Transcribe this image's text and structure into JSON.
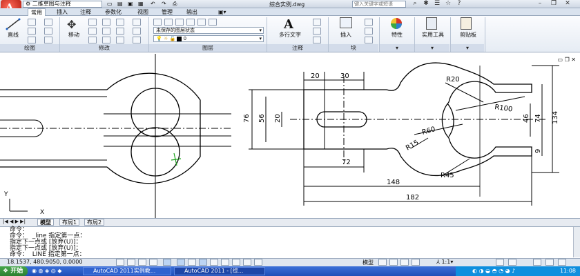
{
  "title_bar": {
    "workspace": "二维草图与注释",
    "title": "综合实例.dwg",
    "help_placeholder": "键入关键字或短语"
  },
  "tabs": [
    "常用",
    "插入",
    "注释",
    "参数化",
    "视图",
    "管理",
    "输出"
  ],
  "ribbon": {
    "draw": {
      "line_label": "直线",
      "panel_title": "绘图"
    },
    "modify": {
      "move_label": "移动",
      "panel_title": "修改"
    },
    "layers": {
      "state_value": "未保存的图层状态",
      "layer_value": "0",
      "panel_title": "图层"
    },
    "annotation": {
      "mtext_label": "多行文字",
      "panel_title": "注释"
    },
    "block": {
      "insert_label": "插入",
      "panel_title": "块"
    },
    "properties_label": "特性",
    "utilities_label": "实用工具",
    "clipboard_label": "剪贴板"
  },
  "drawing": {
    "dims": [
      "20",
      "30",
      "R20",
      "R100",
      "76",
      "56",
      "20",
      "46",
      "74",
      "134",
      "R60",
      "R15",
      "9",
      "72",
      "R45",
      "148",
      "182"
    ],
    "ucs": {
      "x": "X",
      "y": "Y"
    }
  },
  "layout_tabs": [
    "模型",
    "布局1",
    "布局2"
  ],
  "command_lines": [
    "命令：",
    "命令：  _line 指定第一点：",
    "指定下一点或 [放弃(U)]：",
    "指定下一点或 [放弃(U)]：",
    "命令：  LINE 指定第一点："
  ],
  "status": {
    "coords": "18.1537,  480.9050, 0.0000",
    "model_label": "模型",
    "scale": "1:1"
  },
  "taskbar": {
    "start": "开始",
    "tasks": [
      "AutoCAD 2011实例教...",
      "AutoCAD 2011 - [综..."
    ],
    "clock": "11:08"
  },
  "colors": {
    "accent": "#1f4fb8",
    "app_red": "#b21a0e",
    "ribbon_bg": "#e6ecf4",
    "ucs_green": "#1aa11a"
  }
}
